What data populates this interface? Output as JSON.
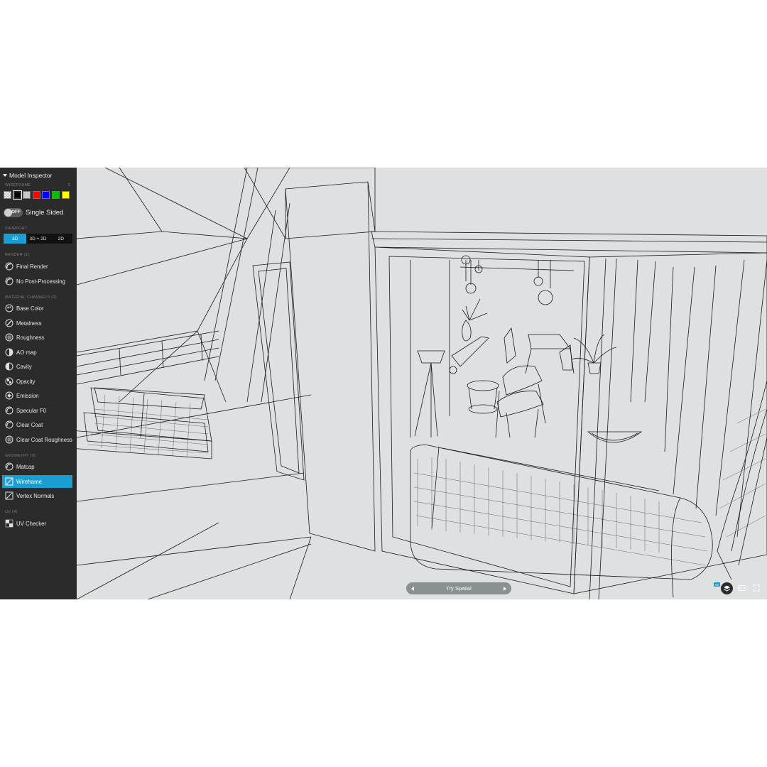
{
  "panel": {
    "title": "Model Inspector"
  },
  "wireframe": {
    "label": "WIREFRAME",
    "value": "5",
    "colors": [
      "#ffffff",
      "#000000",
      "#c8c8c8",
      "#ff0000",
      "#0000ff",
      "#00c000",
      "#ffff00"
    ]
  },
  "single_sided": {
    "state": "OFF",
    "label": "Single Sided"
  },
  "viewport": {
    "label": "VIEWPORT",
    "options": [
      "3D",
      "3D + 2D",
      "2D"
    ],
    "selected": "3D"
  },
  "render": {
    "label": "RENDER (1)",
    "items": [
      {
        "label": "Final Render",
        "icon": "final-render-icon"
      },
      {
        "label": "No Post-Processing",
        "icon": "no-post-processing-icon"
      }
    ]
  },
  "material_channels": {
    "label": "MATERIAL CHANNELS (2)",
    "items": [
      {
        "label": "Base Color",
        "icon": "base-color-icon"
      },
      {
        "label": "Metalness",
        "icon": "metalness-icon"
      },
      {
        "label": "Roughness",
        "icon": "roughness-icon"
      },
      {
        "label": "AO map",
        "icon": "ao-map-icon"
      },
      {
        "label": "Cavity",
        "icon": "cavity-icon"
      },
      {
        "label": "Opacity",
        "icon": "opacity-icon"
      },
      {
        "label": "Emission",
        "icon": "emission-icon"
      },
      {
        "label": "Specular F0",
        "icon": "specular-icon"
      },
      {
        "label": "Clear Coat",
        "icon": "clear-coat-icon"
      },
      {
        "label": "Clear Coat Roughness",
        "icon": "clear-coat-roughness-icon"
      }
    ]
  },
  "geometry": {
    "label": "GEOMETRY (3)",
    "items": [
      {
        "label": "Matcap",
        "icon": "matcap-icon"
      },
      {
        "label": "Wireframe",
        "icon": "wireframe-icon",
        "active": true
      },
      {
        "label": "Vertex Normals",
        "icon": "vertex-normals-icon"
      }
    ]
  },
  "uv": {
    "label": "UV (4)",
    "items": [
      {
        "label": "UV Checker",
        "icon": "uv-checker-icon"
      }
    ]
  },
  "try_spatial": {
    "label": "Try Spatial"
  },
  "viewport_controls": {
    "hd": "HD",
    "icons": [
      "layers-icon",
      "vr-icon",
      "fullscreen-icon"
    ]
  },
  "colors": {
    "accent": "#1a9dd1",
    "sidebar_bg": "#2b2b2b",
    "viewport_bg": "#dde1e1"
  }
}
